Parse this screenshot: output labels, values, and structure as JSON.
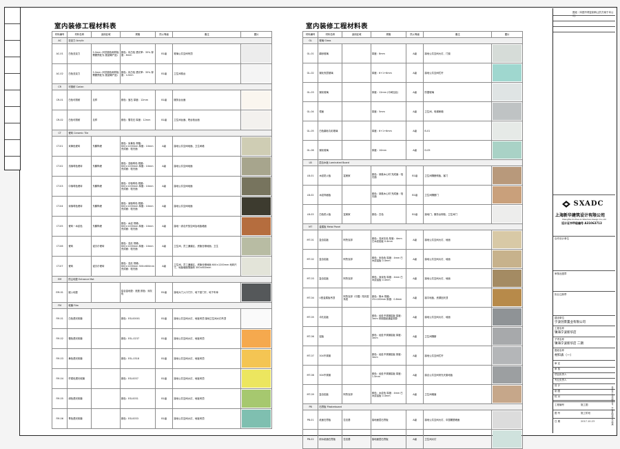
{
  "title_left": "室内装修工程材料表",
  "title_right": "室内装修工程材料表",
  "headers": [
    "材料编号",
    "材料名称",
    "适用区域",
    "规格",
    "防火等级",
    "备注",
    "图片"
  ],
  "left_groups": [
    {
      "code": "AC",
      "label": "亚克力 Acrylic",
      "rows": [
        {
          "code": "AC-01",
          "name": "白色亚克力",
          "area": "3.0mm\n(可供颜色和样板需要预处为\n施品确产品)",
          "spec": "颜色：乳白色\n透光率：35%\n厚度：8mm",
          "fire": "B1级",
          "note": "玻璃公共空间吊顶",
          "color": "#ececec"
        },
        {
          "code": "AC-02",
          "name": "白色亚克力",
          "area": "3.0mm\n(可供颜色和样板需要预处为\n施品确产品)",
          "spec": "颜色：乳白色\n透光率：35%\n厚度：12mm",
          "fire": "B1级",
          "note": "卫生间梳台",
          "color": "#f4f4f4"
        }
      ]
    },
    {
      "code": "CR",
      "label": "可丽耐 Corian",
      "rows": [
        {
          "code": "CR-01",
          "name": "白色可丽耐",
          "area": "见样",
          "spec": "颜色：宝石\n厚度：12mm",
          "fire": "B1级",
          "note": "服务台台面",
          "color": "#faf6ef"
        },
        {
          "code": "CR-02",
          "name": "白色可丽耐",
          "area": "见样",
          "spec": "颜色：雪花石\n厚度：12mm",
          "fire": "B1级",
          "note": "卫生间台面、吧台柜台面",
          "color": "#f3f1ee"
        }
      ]
    },
    {
      "code": "CT",
      "label": "瓷砖 Ceramic Tile",
      "rows": [
        {
          "code": "CT-01",
          "name": "米黄色瓷砖",
          "area": "东鹏陶瓷",
          "spec": "颜色：米黄色\n规格：600×1200mm\n厚度：10mm\n完成面：哑光面",
          "fire": "A级",
          "note": "接地公共空间地面、卫生间墙",
          "color": "#cfcdb4"
        },
        {
          "code": "CT-02",
          "name": "浅咖啡色瓷砖",
          "area": "东鹏陶瓷",
          "spec": "颜色：浅咖啡色\n规格：600×1200mm\n厚度：10mm\n完成面：哑光面",
          "fire": "A级",
          "note": "接地公共空间地面",
          "color": "#a7a58d"
        },
        {
          "code": "CT-03",
          "name": "中咖啡色瓷砖",
          "area": "东鹏陶瓷",
          "spec": "颜色：中咖啡色\n规格：600×1200mm\n厚度：10mm\n完成面：哑光面",
          "fire": "A级",
          "note": "接地公共空间地面",
          "color": "#77745e"
        },
        {
          "code": "CT-04",
          "name": "深咖啡色瓷砖",
          "area": "东鹏陶瓷",
          "spec": "颜色：深咖啡色\n规格：600×1200mm\n厚度：10mm\n完成面：哑光面",
          "fire": "A级",
          "note": "接地公共空间地面",
          "color": "#3d3b2f"
        },
        {
          "code": "CT-05",
          "name": "瓷砖－木纹色",
          "area": "东鹏陶瓷",
          "spec": "颜色：木纹\n规格：600×1200mm\n厚度：10mm\n完成面：哑光面",
          "fire": "A级",
          "note": "接地－综合开放空间及地板墙面",
          "color": "#b56d3e"
        },
        {
          "code": "CT-06",
          "name": "瓷砖",
          "area": "诺贝尔瓷砖",
          "spec": "颜色：浅灰\n规格：600×1200mm\n厚度：10mm\n完成面：哑光面",
          "fire": "A级",
          "note": "卫生间、员工通道区、资管仓储地面、卫生",
          "color": "#b8bca3"
        },
        {
          "code": "CT-07",
          "name": "瓷砖",
          "area": "诺贝尔瓷砖",
          "spec": "颜色：浅灰\n规格：600×1200mm\n300×600mm\n完成面：哑光面",
          "fire": "A级",
          "note": "卫生间、员工通道区、资管仓储地面 600×1200mm\n地砖尺寸、地板墙面薄面砖 300×600mm",
          "color": "#e3e4d9"
        }
      ]
    },
    {
      "code": "EM",
      "label": "防尘地垫 Entrance Mat",
      "rows": [
        {
          "code": "EM-01",
          "name": "嵌入地垫",
          "area": "",
          "spec": "铝合金地垫：底座\n颜色：深灰色",
          "fire": "B1级",
          "note": "接地大门入口门厅、地下室门厅、地下车库",
          "color": "#55585a"
        }
      ]
    },
    {
      "code": "FM",
      "label": "软膜 Film",
      "rows": [
        {
          "code": "FM-01",
          "name": "白色透光软膜",
          "area": "",
          "spec": "颜色：ESL00001",
          "fire": "B1级",
          "note": "接地公共空间大灯、地板吊顶\n接地卫生间大灯吊顶",
          "color": "#fafafa"
        },
        {
          "code": "FM-02",
          "name": "橙色透光软膜",
          "area": "",
          "spec": "颜色：ESL-0237",
          "fire": "B1级",
          "note": "接地公共空间大灯、地板吊顶",
          "color": "#f5a94e"
        },
        {
          "code": "FM-03",
          "name": "黄色透光软膜",
          "area": "",
          "spec": "颜色：ESL-0318",
          "fire": "B1级",
          "note": "接地公共空间大灯、地板吊顶",
          "color": "#f4c553"
        },
        {
          "code": "FM-04",
          "name": "柠檬色透光软膜",
          "area": "",
          "spec": "颜色：ESL0037",
          "fire": "B1级",
          "note": "接地公共空间大灯、地板吊顶",
          "color": "#ece65f"
        },
        {
          "code": "FM-05",
          "name": "绿色透光软膜",
          "area": "",
          "spec": "颜色：ESL0031",
          "fire": "B1级",
          "note": "接地公共空间大灯、地板吊顶",
          "color": "#a6c86f"
        },
        {
          "code": "FM-06",
          "name": "青色透光软膜",
          "area": "",
          "spec": "颜色：ESL0033",
          "fire": "B1级",
          "note": "接地公共空间大灯、地板吊顶",
          "color": "#7fbfb0"
        }
      ]
    }
  ],
  "right_groups": [
    {
      "code": "GL",
      "label": "玻璃 Glass",
      "rows": [
        {
          "code": "GL-01",
          "name": "磨砂玻璃",
          "area": "",
          "spec": "厚度：8mm",
          "fire": "A级",
          "note": "接地公共空间大灯、门窗",
          "color": "#d6dcd8"
        },
        {
          "code": "GL-02",
          "name": "钢化夹层玻璃",
          "area": "",
          "spec": "厚度：6+1+6mm",
          "fire": "A级",
          "note": "接地公共空间栏杆",
          "color": "#9fd7cf"
        },
        {
          "code": "GL-03",
          "name": "钢化玻璃",
          "area": "",
          "spec": "厚度：12mm\n(中间加丝)",
          "fire": "A级",
          "note": "防撞玻璃",
          "color": "#dfe4e4"
        },
        {
          "code": "GL-04",
          "name": "镜面",
          "area": "",
          "spec": "厚度：5mm",
          "fire": "A级",
          "note": "卫生间、电梯轿厢",
          "color": "#bfc3c4"
        },
        {
          "code": "GL-05",
          "name": "白色磨砂丸彩玻璃",
          "area": "",
          "spec": "厚度：6+1+6mm",
          "fire": "A级",
          "note": "B-01",
          "color": "#e6eae7"
        },
        {
          "code": "GL-06",
          "name": "钢化玻璃",
          "area": "",
          "spec": "厚度：10mm",
          "fire": "A级",
          "note": "D-05",
          "color": "#a9d2c6"
        }
      ]
    },
    {
      "code": "LB",
      "label": "层合木板 Laminated Board",
      "rows": [
        {
          "code": "LB-01",
          "name": "木纹防火板",
          "area": "富美家",
          "spec": "颜色：胡桃木心材\n完成面：哑光面",
          "fire": "B1级",
          "note": "卫生间隔断侧板、客门",
          "color": "#b8997b"
        },
        {
          "code": "LB-02",
          "name": "木纹饰面板",
          "area": "",
          "spec": "颜色：胡桃木心材\n完成面：哑光面",
          "fire": "B1级",
          "note": "卫生间隔断门",
          "color": "#c9a07b"
        },
        {
          "code": "LB-03",
          "name": "白色防火板",
          "area": "富美家",
          "spec": "颜色：白色",
          "fire": "B1级",
          "note": "接地门、服务台侧柜、卫生间门",
          "color": "#ededec"
        }
      ]
    },
    {
      "code": "MT",
      "label": "金属板 Metal Panel",
      "rows": [
        {
          "code": "MT-01",
          "name": "复合铝板",
          "area": "阿鲁克邦",
          "spec": "颜色：浅米灰色\n厚度：4mm\n已木纹铝板 0.4mm",
          "fire": "A级",
          "note": "接地公共空间大灯、地面",
          "color": "#d8c9a6"
        },
        {
          "code": "MT-02",
          "name": "复合铝板",
          "area": "阿鲁克邦",
          "spec": "颜色：米色色\n厚度：4mm\n已木纹铝板 0.4mm",
          "fire": "A级",
          "note": "接地公共空间大灯、地面",
          "color": "#c7b28c"
        },
        {
          "code": "MT-03",
          "name": "复合铝板",
          "area": "阿鲁克邦",
          "spec": "颜色：深米色\n厚度：4mm\n已木纹铝板 0.4mm",
          "fire": "A级",
          "note": "接地公共空间大灯、地面",
          "color": "#a48b63"
        },
        {
          "code": "MT-04",
          "name": "U型金属板吊顶",
          "area": "阿鲁克邦（中国）阳光型系统",
          "spec": "颜色：橡木\n规格：25×100mm\n厚度：0.8mm",
          "fire": "A级",
          "note": "接平地板、资源回天顶",
          "color": "#b78a4a"
        },
        {
          "code": "MT-05",
          "name": "冲孔铝板",
          "area": "",
          "spec": "颜色：经处不锈钢铝板\n厚度：3mm\n采用图纸通量测算",
          "fire": "A级",
          "note": "接地公共空间大灯、地面",
          "color": "#8f9396"
        },
        {
          "code": "MT-06",
          "name": "铝板",
          "area": "",
          "spec": "颜色：经处不锈钢铝板\n厚度：3mm",
          "fire": "A级",
          "note": "卫生间隔断",
          "color": "#a7a9ab"
        },
        {
          "code": "MT-07",
          "name": "304不锈钢",
          "area": "",
          "spec": "颜色：经处不锈钢铝板\n厚度：3mm",
          "fire": "A级",
          "note": "接地公共空间栏杆",
          "color": "#b4b6b8"
        },
        {
          "code": "MT-08",
          "name": "304不锈钢",
          "area": "",
          "spec": "颜色：经处不锈钢铝板\n厚度：1.5mm",
          "fire": "A级",
          "note": "接合公共空间采光天窗地板",
          "color": "#9c9fa1"
        },
        {
          "code": "MT-09",
          "name": "复合铝板",
          "area": "阿鲁克邦",
          "spec": "颜色：木纹色\n厚度：4mm\n已木纹铝板 0.4mm",
          "fire": "A级",
          "note": "卫生间墙面",
          "color": "#c6a78a"
        }
      ]
    },
    {
      "code": "PB",
      "label": "石膏板 Plasterboard",
      "rows": [
        {
          "code": "PB-01",
          "name": "纸面石膏板",
          "area": "拉法基",
          "spec": "接地面层石膏板",
          "fire": "A级",
          "note": "接地公共空间大灯、中国雕塑墙面",
          "color": "#dcdcdc"
        },
        {
          "code": "PB-02",
          "name": "耐水纸面石膏板",
          "area": "拉法基",
          "spec": "接地面层石膏板",
          "fire": "A级",
          "note": "卫生间大灯",
          "color": "#cfe2dd"
        }
      ]
    }
  ],
  "title_block": {
    "top_note": "图纸（本图不得复制转让的方案于本公司）",
    "logo": "SXADC",
    "company": "上海新华建筑设计有限公司",
    "company_en": "ShangHai XinHua Architecture Design Co.,Ltd",
    "cert": "设计证书甲级编号 A31063713",
    "design_label": "合作设计单位",
    "stamp_label": "审核出图章",
    "reg_label": "执业注册章",
    "client_label": "建设单位",
    "client": "宁波创景置业有限公司",
    "project_label": "工程名称",
    "project": "镇海宁波新华店",
    "sub_label": "子项名称",
    "sub": "镇海宁波新华店 二期",
    "drawing_label": "图纸名称",
    "drawing": "材料表（一）",
    "rows": [
      "审 定",
      "审 核",
      "项目负责人",
      "专业负责人",
      "设 计",
      "制 图",
      "校 对"
    ],
    "phase_label": "工程编号",
    "phase": "施工图",
    "sheet_no_label": "图 号",
    "sheet_no": "施工阶段",
    "date_label": "日 期",
    "date": "2017.10.23",
    "vertical_note": "未经本公司书面许可，不得复制或作为他用"
  }
}
